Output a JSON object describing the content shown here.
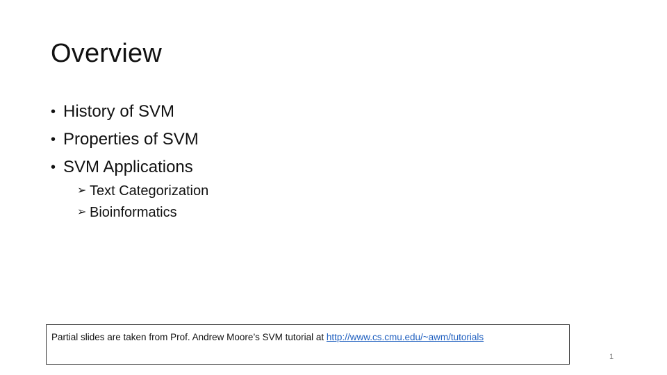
{
  "slide": {
    "title": "Overview",
    "bullets": [
      {
        "label": "History of SVM"
      },
      {
        "label": "Properties of SVM"
      },
      {
        "label": "SVM Applications"
      }
    ],
    "subitems": [
      {
        "label": "Text Categorization"
      },
      {
        "label": "Bioinformatics"
      }
    ],
    "bullet_glyph": "•",
    "subitem_glyph": "➢",
    "footnote": {
      "text": "Partial slides are taken from  Prof. Andrew Moore’s SVM tutorial at ",
      "link_text": "http://www.cs.cmu.edu/~awm/tutorials"
    },
    "page_number": "1"
  },
  "colors": {
    "link": "#1f5fbf",
    "page_number": "#7a7a7a",
    "text": "#111111"
  }
}
